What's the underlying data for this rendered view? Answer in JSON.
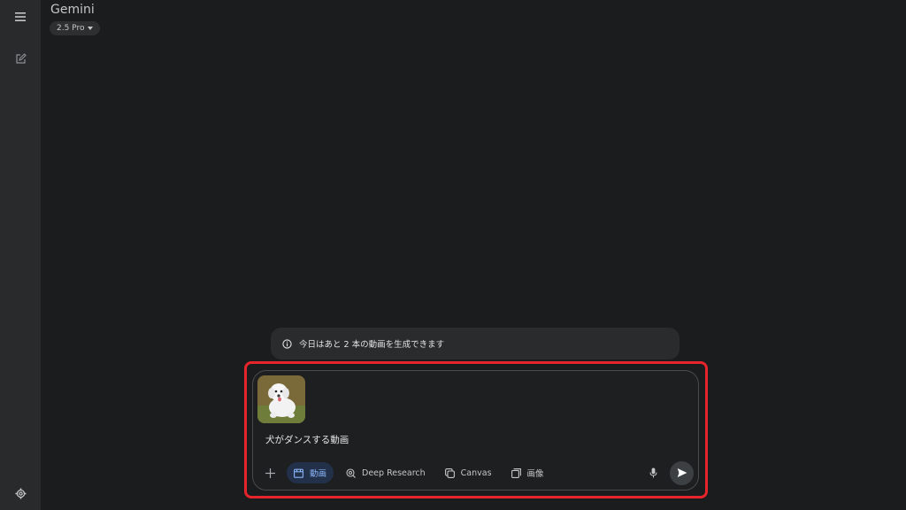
{
  "app": {
    "title": "Gemini",
    "model": "2.5 Pro"
  },
  "banner": {
    "text": "今日はあと 2 本の動画を生成できます"
  },
  "composer": {
    "prompt": "犬がダンスする動画",
    "tools": [
      {
        "label": "動画",
        "icon": "video-icon",
        "active": true
      },
      {
        "label": "Deep Research",
        "icon": "deep-research-icon",
        "active": false
      },
      {
        "label": "Canvas",
        "icon": "canvas-icon",
        "active": false
      },
      {
        "label": "画像",
        "icon": "image-icon",
        "active": false
      }
    ]
  },
  "colors": {
    "highlight": "#e5252b",
    "accent": "#8ab4f8",
    "background": "#1b1c1d"
  }
}
